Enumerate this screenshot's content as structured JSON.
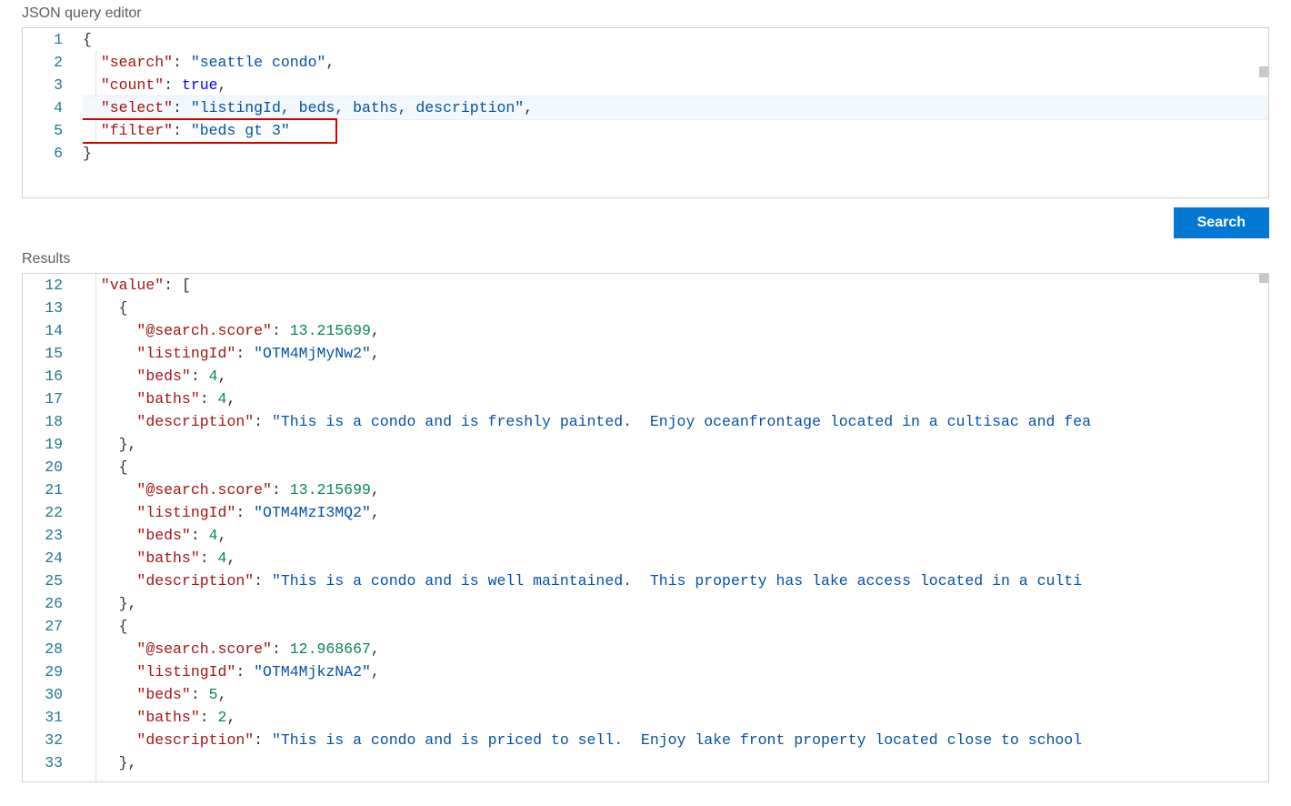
{
  "labels": {
    "query_editor": "JSON query editor",
    "results": "Results",
    "search_button": "Search"
  },
  "colors": {
    "accent": "#0078d4",
    "key": "#a31515",
    "string": "#0451a5",
    "number": "#098658",
    "keyword": "#0000ff",
    "highlight_border": "#d30000"
  },
  "query_editor": {
    "current_line": 4,
    "line_numbers": [
      "1",
      "2",
      "3",
      "4",
      "5",
      "6"
    ],
    "highlight_line": 5,
    "tokens": {
      "l1_brace": "{",
      "l2_key": "\"search\"",
      "l2_colon": ": ",
      "l2_val": "\"seattle condo\"",
      "l2_comma": ",",
      "l3_key": "\"count\"",
      "l3_colon": ": ",
      "l3_val": "true",
      "l3_comma": ",",
      "l4_key": "\"select\"",
      "l4_colon": ": ",
      "l4_val": "\"listingId, beds, baths, description\"",
      "l4_comma": ",",
      "l5_key": "\"filter\"",
      "l5_colon": ": ",
      "l5_val": "\"beds gt 3\"",
      "l6_brace": "}"
    }
  },
  "results_editor": {
    "line_numbers": [
      "12",
      "13",
      "14",
      "15",
      "16",
      "17",
      "18",
      "19",
      "20",
      "21",
      "22",
      "23",
      "24",
      "25",
      "26",
      "27",
      "28",
      "29",
      "30",
      "31",
      "32",
      "33"
    ],
    "tokens": {
      "l12_key": "\"value\"",
      "l12_colon": ": ",
      "l12_bracket": "[",
      "l13_brace": "{",
      "l14_key": "\"@search.score\"",
      "l14_colon": ": ",
      "l14_val": "13.215699",
      "l14_comma": ",",
      "l15_key": "\"listingId\"",
      "l15_colon": ": ",
      "l15_val": "\"OTM4MjMyNw2\"",
      "l15_comma": ",",
      "l16_key": "\"beds\"",
      "l16_colon": ": ",
      "l16_val": "4",
      "l16_comma": ",",
      "l17_key": "\"baths\"",
      "l17_colon": ": ",
      "l17_val": "4",
      "l17_comma": ",",
      "l18_key": "\"description\"",
      "l18_colon": ": ",
      "l18_val": "\"This is a condo and is freshly painted.  Enjoy oceanfrontage located in a cultisac and fea",
      "l19_close": "},",
      "l20_brace": "{",
      "l21_key": "\"@search.score\"",
      "l21_colon": ": ",
      "l21_val": "13.215699",
      "l21_comma": ",",
      "l22_key": "\"listingId\"",
      "l22_colon": ": ",
      "l22_val": "\"OTM4MzI3MQ2\"",
      "l22_comma": ",",
      "l23_key": "\"beds\"",
      "l23_colon": ": ",
      "l23_val": "4",
      "l23_comma": ",",
      "l24_key": "\"baths\"",
      "l24_colon": ": ",
      "l24_val": "4",
      "l24_comma": ",",
      "l25_key": "\"description\"",
      "l25_colon": ": ",
      "l25_val": "\"This is a condo and is well maintained.  This property has lake access located in a culti",
      "l26_close": "},",
      "l27_brace": "{",
      "l28_key": "\"@search.score\"",
      "l28_colon": ": ",
      "l28_val": "12.968667",
      "l28_comma": ",",
      "l29_key": "\"listingId\"",
      "l29_colon": ": ",
      "l29_val": "\"OTM4MjkzNA2\"",
      "l29_comma": ",",
      "l30_key": "\"beds\"",
      "l30_colon": ": ",
      "l30_val": "5",
      "l30_comma": ",",
      "l31_key": "\"baths\"",
      "l31_colon": ": ",
      "l31_val": "2",
      "l31_comma": ",",
      "l32_key": "\"description\"",
      "l32_colon": ": ",
      "l32_val": "\"This is a condo and is priced to sell.  Enjoy lake front property located close to school",
      "l33_close": "},"
    }
  }
}
